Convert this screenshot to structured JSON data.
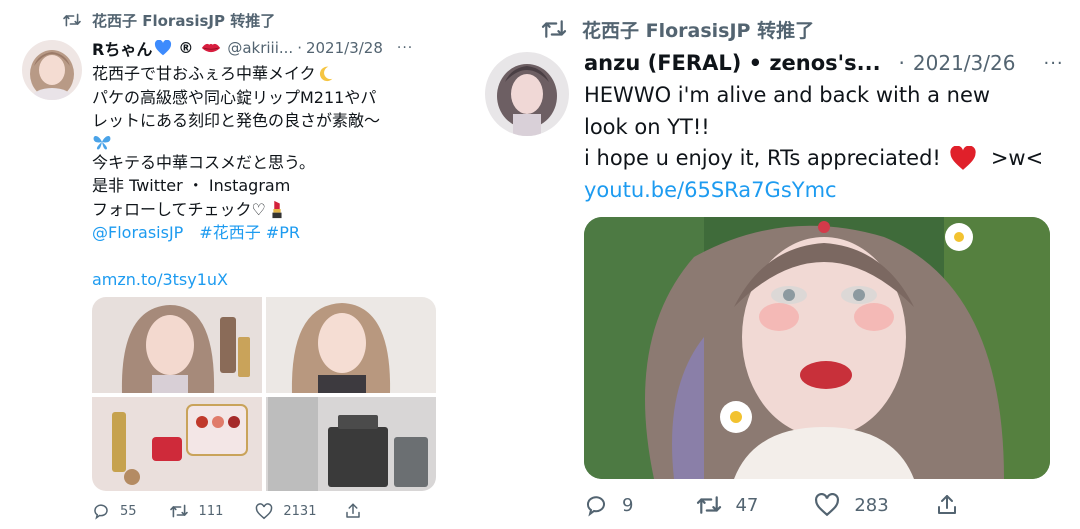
{
  "left_tweet": {
    "retweeted_by": "花西子 FlorasisJP 转推了",
    "author_name": "Rちゃん",
    "author_badge": "®",
    "handle": "@akriii...",
    "dot": "·",
    "date": "2021/3/28",
    "more": "···",
    "text_lines": [
      "花西子で甘おふぇろ中華メイク",
      "パケの高級感や同心錠リップM211やパ",
      "レットにある刻印と発色の良さが素敵～",
      "今キテる中華コスメだと思う。",
      "是非 Twitter ・ Instagram",
      "フォローしてチェック♡"
    ],
    "mentions": "@FlorasisJP　#花西子 #PR",
    "link": "amzn.to/3tsy1uX",
    "counts": {
      "replies": "55",
      "retweets": "111",
      "likes": "2131"
    },
    "icons": [
      "retweet-icon",
      "blue-heart-icon",
      "lips-icon",
      "moon-icon",
      "butterfly-icon",
      "lipstick-icon",
      "reply-icon",
      "like-icon",
      "share-icon"
    ]
  },
  "right_tweet": {
    "retweeted_by": "花西子 FlorasisJP 转推了",
    "author_name": "anzu (FERAL) • zenos's...",
    "dot": "·",
    "date": "2021/3/26",
    "more": "···",
    "text_lines": [
      "HEWWO i'm alive and back with a new",
      "look on YT!!",
      "i hope u enjoy it, RTs appreciated!",
      ">w<"
    ],
    "link": "youtu.be/65SRa7GsYmc",
    "counts": {
      "replies": "9",
      "retweets": "47",
      "likes": "283"
    },
    "icons": [
      "retweet-icon",
      "red-heart-icon",
      "reply-icon",
      "like-icon",
      "share-icon"
    ]
  },
  "colors": {
    "text": "#0f1419",
    "secondary": "#536471",
    "link": "#1d9bf0"
  }
}
